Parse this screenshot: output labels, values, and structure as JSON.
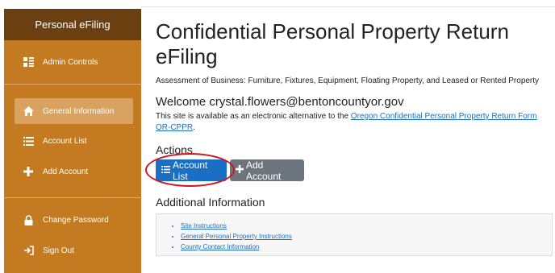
{
  "sidebar": {
    "header": "Personal eFiling",
    "items": [
      {
        "label": "Admin Controls",
        "icon": "admin-controls-icon"
      },
      {
        "label": "General Information",
        "icon": "home-icon"
      },
      {
        "label": "Account List",
        "icon": "list-icon"
      },
      {
        "label": "Add Account",
        "icon": "plus-icon"
      },
      {
        "label": "Change Password",
        "icon": "lock-icon"
      },
      {
        "label": "Sign Out",
        "icon": "sign-out-icon"
      }
    ]
  },
  "main": {
    "title": "Confidential Personal Property Return eFiling",
    "subtitle": "Assessment of Business: Furniture, Fixtures, Equipment, Floating Property, and Leased or Rented Property",
    "welcome": "Welcome crystal.flowers@bentoncountyor.gov",
    "description_prefix": "This site is available as an electronic alternative to the ",
    "description_link": "Oregon Confidential Personal Property Return Form OR-CPPR",
    "description_suffix": ".",
    "actions_heading": "Actions",
    "buttons": {
      "account_list": "Account List",
      "add_account": "Add Account"
    },
    "additional_heading": "Additional Information",
    "links": [
      "Site Instructions",
      "General Personal Property Instructions",
      "County Contact Information"
    ]
  },
  "colors": {
    "sidebar": "#c47a20",
    "sidebar_header": "#6b4010",
    "primary": "#1a6fc4",
    "secondary": "#6c757d",
    "annotation": "#d1141b"
  }
}
